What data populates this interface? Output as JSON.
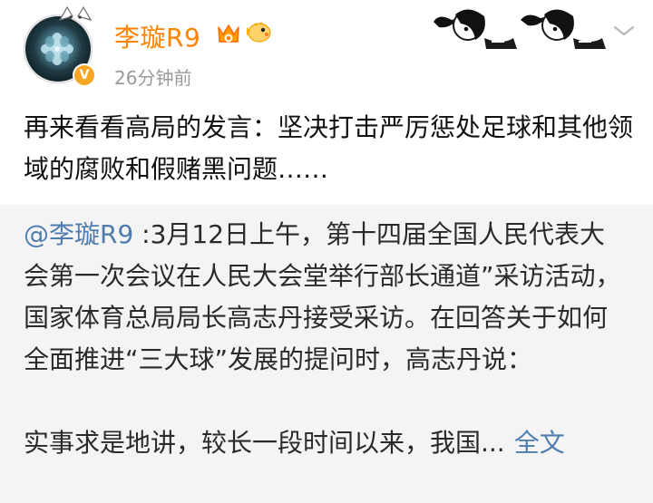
{
  "user": {
    "name": "李璇R9",
    "time": "26分钟前",
    "avatar_badge": "V",
    "icons": [
      "vip-crown-icon",
      "pufferfish-emoji-icon",
      "anime-girls-decoration",
      "chevron-down-icon"
    ]
  },
  "post": {
    "text": "再来看看高局的发言：坚决打击严厉惩处足球和其他领域的腐败和假赌黑问题……"
  },
  "repost": {
    "mention": "@李璇R9",
    "body": " :3月12日上午，第十四届全国人民代表大会第一次会议在人民大会堂举行部长通道”采访活动，国家体育总局局长高志丹接受采访。在回答关于如何全面推进“三大球”发展的提问时，高志丹说：",
    "last_line": "实事求是地讲，较长一段时间以来，我国...",
    "full_text_link": "全文"
  },
  "colors": {
    "name": "#ff8200",
    "link": "#507daf",
    "repost_bg": "#f4f4f4",
    "time": "#9a9a9a"
  }
}
